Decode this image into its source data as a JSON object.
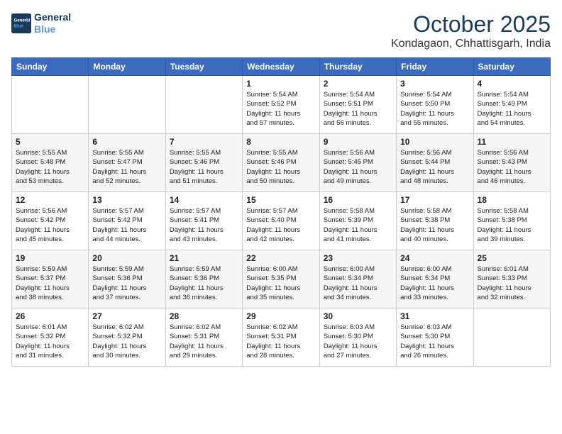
{
  "logo": {
    "line1": "General",
    "line2": "Blue"
  },
  "title": "October 2025",
  "location": "Kondagaon, Chhattisgarh, India",
  "days_of_week": [
    "Sunday",
    "Monday",
    "Tuesday",
    "Wednesday",
    "Thursday",
    "Friday",
    "Saturday"
  ],
  "weeks": [
    [
      {
        "day": "",
        "info": ""
      },
      {
        "day": "",
        "info": ""
      },
      {
        "day": "",
        "info": ""
      },
      {
        "day": "1",
        "info": "Sunrise: 5:54 AM\nSunset: 5:52 PM\nDaylight: 11 hours\nand 57 minutes."
      },
      {
        "day": "2",
        "info": "Sunrise: 5:54 AM\nSunset: 5:51 PM\nDaylight: 11 hours\nand 56 minutes."
      },
      {
        "day": "3",
        "info": "Sunrise: 5:54 AM\nSunset: 5:50 PM\nDaylight: 11 hours\nand 55 minutes."
      },
      {
        "day": "4",
        "info": "Sunrise: 5:54 AM\nSunset: 5:49 PM\nDaylight: 11 hours\nand 54 minutes."
      }
    ],
    [
      {
        "day": "5",
        "info": "Sunrise: 5:55 AM\nSunset: 5:48 PM\nDaylight: 11 hours\nand 53 minutes."
      },
      {
        "day": "6",
        "info": "Sunrise: 5:55 AM\nSunset: 5:47 PM\nDaylight: 11 hours\nand 52 minutes."
      },
      {
        "day": "7",
        "info": "Sunrise: 5:55 AM\nSunset: 5:46 PM\nDaylight: 11 hours\nand 51 minutes."
      },
      {
        "day": "8",
        "info": "Sunrise: 5:55 AM\nSunset: 5:46 PM\nDaylight: 11 hours\nand 50 minutes."
      },
      {
        "day": "9",
        "info": "Sunrise: 5:56 AM\nSunset: 5:45 PM\nDaylight: 11 hours\nand 49 minutes."
      },
      {
        "day": "10",
        "info": "Sunrise: 5:56 AM\nSunset: 5:44 PM\nDaylight: 11 hours\nand 48 minutes."
      },
      {
        "day": "11",
        "info": "Sunrise: 5:56 AM\nSunset: 5:43 PM\nDaylight: 11 hours\nand 46 minutes."
      }
    ],
    [
      {
        "day": "12",
        "info": "Sunrise: 5:56 AM\nSunset: 5:42 PM\nDaylight: 11 hours\nand 45 minutes."
      },
      {
        "day": "13",
        "info": "Sunrise: 5:57 AM\nSunset: 5:42 PM\nDaylight: 11 hours\nand 44 minutes."
      },
      {
        "day": "14",
        "info": "Sunrise: 5:57 AM\nSunset: 5:41 PM\nDaylight: 11 hours\nand 43 minutes."
      },
      {
        "day": "15",
        "info": "Sunrise: 5:57 AM\nSunset: 5:40 PM\nDaylight: 11 hours\nand 42 minutes."
      },
      {
        "day": "16",
        "info": "Sunrise: 5:58 AM\nSunset: 5:39 PM\nDaylight: 11 hours\nand 41 minutes."
      },
      {
        "day": "17",
        "info": "Sunrise: 5:58 AM\nSunset: 5:38 PM\nDaylight: 11 hours\nand 40 minutes."
      },
      {
        "day": "18",
        "info": "Sunrise: 5:58 AM\nSunset: 5:38 PM\nDaylight: 11 hours\nand 39 minutes."
      }
    ],
    [
      {
        "day": "19",
        "info": "Sunrise: 5:59 AM\nSunset: 5:37 PM\nDaylight: 11 hours\nand 38 minutes."
      },
      {
        "day": "20",
        "info": "Sunrise: 5:59 AM\nSunset: 5:36 PM\nDaylight: 11 hours\nand 37 minutes."
      },
      {
        "day": "21",
        "info": "Sunrise: 5:59 AM\nSunset: 5:36 PM\nDaylight: 11 hours\nand 36 minutes."
      },
      {
        "day": "22",
        "info": "Sunrise: 6:00 AM\nSunset: 5:35 PM\nDaylight: 11 hours\nand 35 minutes."
      },
      {
        "day": "23",
        "info": "Sunrise: 6:00 AM\nSunset: 5:34 PM\nDaylight: 11 hours\nand 34 minutes."
      },
      {
        "day": "24",
        "info": "Sunrise: 6:00 AM\nSunset: 5:34 PM\nDaylight: 11 hours\nand 33 minutes."
      },
      {
        "day": "25",
        "info": "Sunrise: 6:01 AM\nSunset: 5:33 PM\nDaylight: 11 hours\nand 32 minutes."
      }
    ],
    [
      {
        "day": "26",
        "info": "Sunrise: 6:01 AM\nSunset: 5:32 PM\nDaylight: 11 hours\nand 31 minutes."
      },
      {
        "day": "27",
        "info": "Sunrise: 6:02 AM\nSunset: 5:32 PM\nDaylight: 11 hours\nand 30 minutes."
      },
      {
        "day": "28",
        "info": "Sunrise: 6:02 AM\nSunset: 5:31 PM\nDaylight: 11 hours\nand 29 minutes."
      },
      {
        "day": "29",
        "info": "Sunrise: 6:02 AM\nSunset: 5:31 PM\nDaylight: 11 hours\nand 28 minutes."
      },
      {
        "day": "30",
        "info": "Sunrise: 6:03 AM\nSunset: 5:30 PM\nDaylight: 11 hours\nand 27 minutes."
      },
      {
        "day": "31",
        "info": "Sunrise: 6:03 AM\nSunset: 5:30 PM\nDaylight: 11 hours\nand 26 minutes."
      },
      {
        "day": "",
        "info": ""
      }
    ]
  ]
}
